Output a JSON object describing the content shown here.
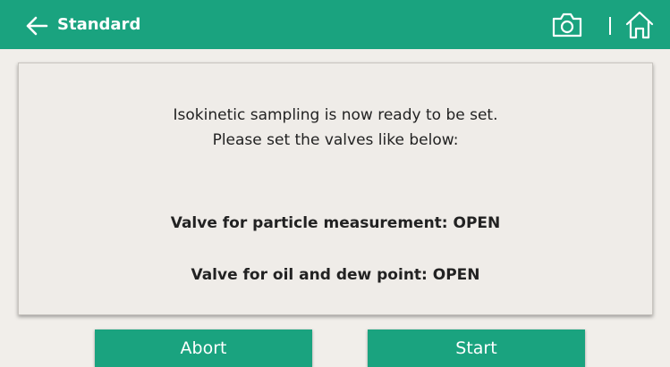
{
  "header": {
    "title": "Standard",
    "back_icon": "arrow-left-icon",
    "camera_icon": "camera-icon",
    "home_icon": "home-icon",
    "bg_color": "#1aa37f"
  },
  "dialog": {
    "line1": "Isokinetic sampling is now ready to be set.",
    "line2": "Please set the valves like below:",
    "valve_particle": "Valve for particle measurement: OPEN",
    "valve_oil": "Valve for oil and dew point: OPEN"
  },
  "buttons": {
    "abort_label": "Abort",
    "start_label": "Start",
    "color": "#1aa37f"
  }
}
